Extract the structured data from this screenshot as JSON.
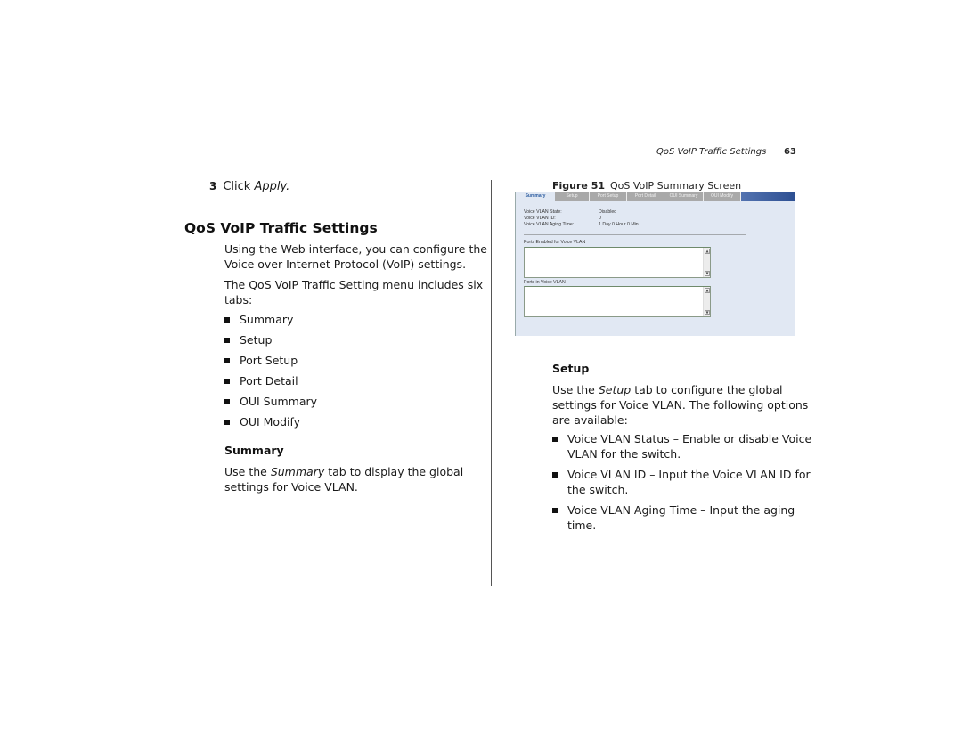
{
  "header": {
    "running_title": "QoS VoIP Traffic Settings",
    "page_number": "63"
  },
  "left": {
    "step_number": "3",
    "step_text": "Click ",
    "step_emphasis": "Apply.",
    "section_title": "QoS VoIP Traffic Settings",
    "intro_line1": "Using the Web interface, you can configure the",
    "intro_line2": "Voice over Internet Protocol (VoIP) settings.",
    "menu_line1": "The QoS VoIP Traffic Setting menu includes six",
    "menu_line2": "tabs:",
    "tabs_list": [
      "Summary",
      "Setup",
      "Port Setup",
      "Port Detail",
      "OUI Summary",
      "OUI Modify"
    ],
    "summary_heading": "Summary",
    "summary_pre": "Use the ",
    "summary_em": "Summary",
    "summary_post": " tab to display the global",
    "summary_line2": "settings for Voice VLAN."
  },
  "figure": {
    "label": "Figure 51",
    "caption": "QoS VoIP Summary Screen",
    "tabs": [
      "Summary",
      "Setup",
      "Port Setup",
      "Port Detail",
      "OUI Summary",
      "OUI Modify"
    ],
    "active_tab": "Summary",
    "fields": [
      {
        "label": "Voice VLAN State:",
        "value": "Disabled"
      },
      {
        "label": "Voice VLAN ID:",
        "value": "0"
      },
      {
        "label": "Voice VLAN Aging Time:",
        "value": "1 Day 0 Hour 0 Min"
      }
    ],
    "box1_label": "Ports Enabled for Voice VLAN",
    "box2_label": "Ports in Voice VLAN",
    "scroll_up": "▲",
    "scroll_down": "▼"
  },
  "right": {
    "setup_heading": "Setup",
    "setup_pre": "Use the ",
    "setup_em": "Setup",
    "setup_post": " tab to configure the global",
    "setup_line2": "settings for Voice VLAN. The following options",
    "setup_line3": "are available:",
    "options": [
      {
        "line1": "Voice VLAN Status – Enable or disable Voice",
        "line2": "VLAN for the switch."
      },
      {
        "line1": "Voice VLAN ID – Input the Voice VLAN ID for",
        "line2": "the switch."
      },
      {
        "line1": "Voice VLAN Aging Time – Input the aging",
        "line2": "time."
      }
    ]
  }
}
